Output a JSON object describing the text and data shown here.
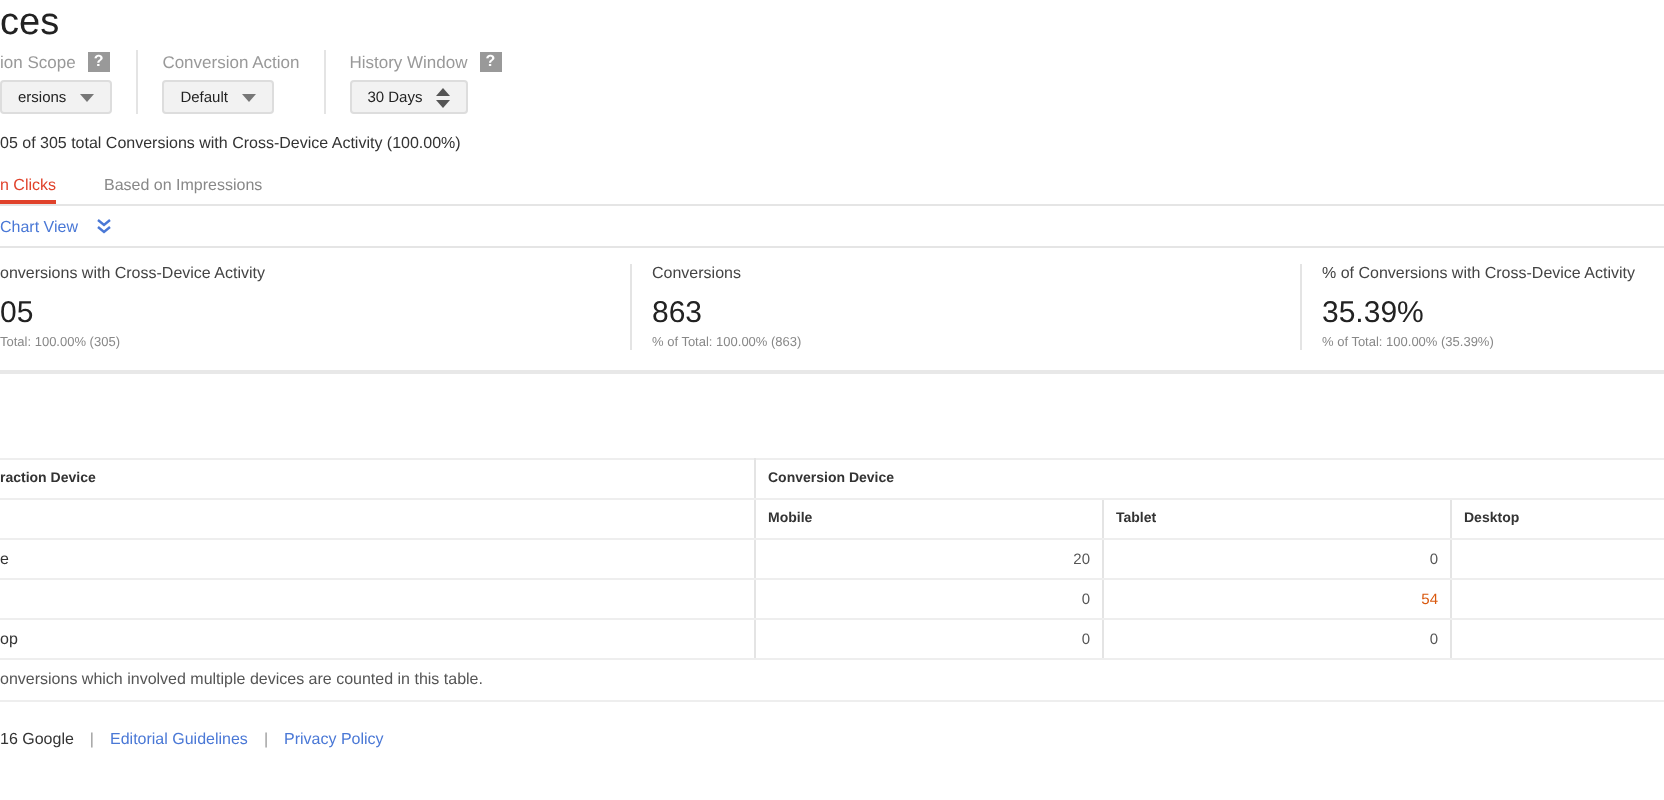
{
  "title": "ces",
  "filters": [
    {
      "label": "ion Scope",
      "help": "?",
      "value": "ersions",
      "kind": "dropdown"
    },
    {
      "label": "Conversion Action",
      "value": "Default",
      "kind": "dropdown"
    },
    {
      "label": "History Window",
      "help": "?",
      "value": "30 Days",
      "kind": "stepper"
    }
  ],
  "summary": "05 of 305 total Conversions with Cross-Device Activity (100.00%)",
  "tabs": [
    {
      "label": "n Clicks",
      "selected": true
    },
    {
      "label": "Based on Impressions",
      "selected": false
    }
  ],
  "chart_toggle": {
    "label": "Chart View",
    "expanded": false
  },
  "scorecards": [
    {
      "title": "onversions with Cross-Device Activity",
      "value": "05",
      "total": "Total: 100.00% (305)"
    },
    {
      "title": "Conversions",
      "value": "863",
      "total": "% of Total: 100.00% (863)"
    },
    {
      "title": "% of Conversions with Cross-Device Activity",
      "value": "35.39%",
      "total": "% of Total: 100.00% (35.39%)"
    }
  ],
  "table": {
    "row_header": "raction Device",
    "group_header": "Conversion Device",
    "columns": [
      "Mobile",
      "Tablet",
      "Desktop"
    ],
    "rows": [
      {
        "label": "e",
        "cells": [
          {
            "value": "20",
            "highlighted": false
          },
          {
            "value": "0",
            "highlighted": false
          }
        ]
      },
      {
        "cells": [
          {
            "value": "0",
            "highlighted": false
          },
          {
            "value": "54",
            "highlighted": true
          }
        ]
      },
      {
        "label": "op",
        "cells": [
          {
            "value": "0",
            "highlighted": false
          },
          {
            "value": "0",
            "highlighted": false
          }
        ]
      }
    ]
  },
  "note": "onversions which involved multiple devices are counted in this table.",
  "footer": {
    "copyright": "16 Google",
    "separator": "|",
    "links": [
      "Editorial Guidelines",
      "Privacy Policy"
    ]
  }
}
